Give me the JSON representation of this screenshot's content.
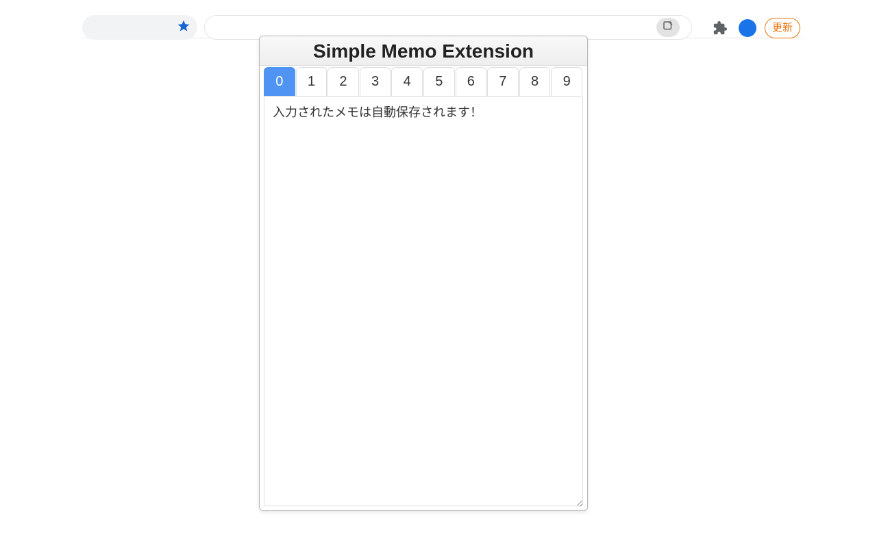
{
  "browser": {
    "update_label": "更新"
  },
  "popup": {
    "title": "Simple Memo Extension",
    "tabs": [
      "0",
      "1",
      "2",
      "3",
      "4",
      "5",
      "6",
      "7",
      "8",
      "9"
    ],
    "active_tab_index": 0,
    "memo_text": "入力されたメモは自動保存されます！"
  }
}
